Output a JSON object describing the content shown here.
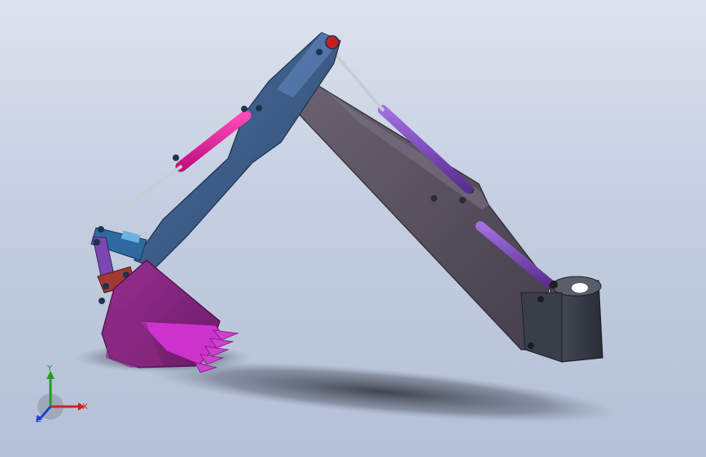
{
  "viewport": {
    "background_top": "#dde3ee",
    "background_bottom": "#b4c0d6"
  },
  "model": {
    "colors": {
      "boom": "#3f5f8c",
      "stick": "#5a5260",
      "bucket": "#8a2a82",
      "teeth": "#cc33cc",
      "cylinder_pink": "#e0189a",
      "cylinder_purple": "#7a48b0",
      "rod": "#c8ccd4",
      "mount": "#3a3e48"
    }
  },
  "triad": {
    "x_label": "X",
    "y_label": "Y",
    "z_label": "Z",
    "x_color": "#d42020",
    "y_color": "#20a020",
    "z_color": "#2040d0"
  }
}
